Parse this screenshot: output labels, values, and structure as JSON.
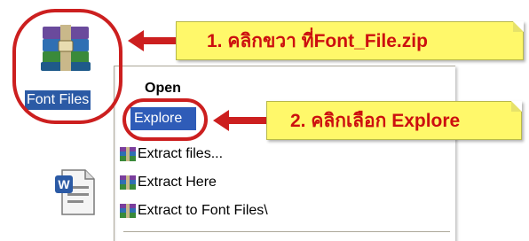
{
  "desktop": {
    "archive_icon": {
      "icon": "winrar-archive-icon",
      "label": "Font Files"
    },
    "doc_icon": {
      "icon": "word-document-icon"
    }
  },
  "context_menu": {
    "items": [
      {
        "label": "Open",
        "icon": ""
      },
      {
        "label": "Explore",
        "icon": "",
        "highlighted": true
      },
      {
        "label": "Extract files...",
        "icon": "winrar-books-icon"
      },
      {
        "label": "Extract Here",
        "icon": "winrar-books-icon"
      },
      {
        "label": "Extract to Font Files\\",
        "icon": "winrar-books-icon"
      }
    ]
  },
  "callouts": {
    "step1": "1. คลิกขวา ที่Font_File.zip",
    "step2": "2. คลิกเลือก Explore"
  },
  "colors": {
    "callout_bg": "#fff86a",
    "callout_text": "#cc0f0f",
    "ring": "#cc1f1f",
    "selection": "#2f5cb8"
  }
}
